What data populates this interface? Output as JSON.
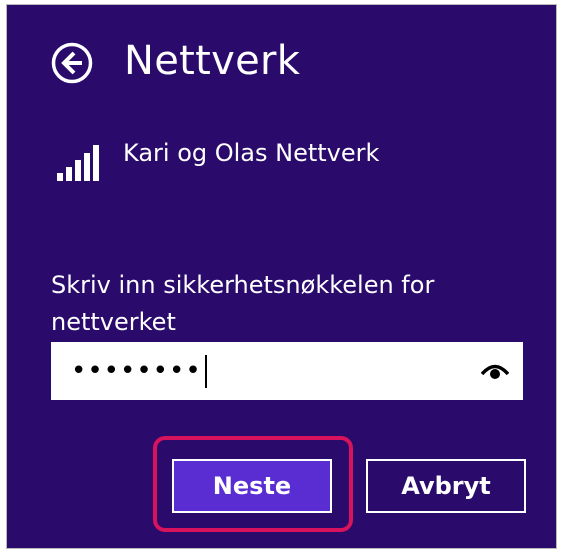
{
  "header": {
    "title": "Nettverk",
    "back_icon": "back-arrow-circle-icon"
  },
  "network": {
    "name": "Kari og Olas Nettverk",
    "signal_icon": "signal-strength-icon",
    "signal_bars": 5
  },
  "security_key": {
    "prompt": "Skriv inn sikkerhetsnøkkelen for nettverket",
    "masked_value": "••••••••",
    "reveal_icon": "eye-icon"
  },
  "buttons": {
    "next_label": "Neste",
    "cancel_label": "Avbryt"
  },
  "colors": {
    "background": "#2a0a6b",
    "accent_button": "#5a2dd2",
    "highlight": "#d6135c",
    "text": "#ffffff"
  }
}
